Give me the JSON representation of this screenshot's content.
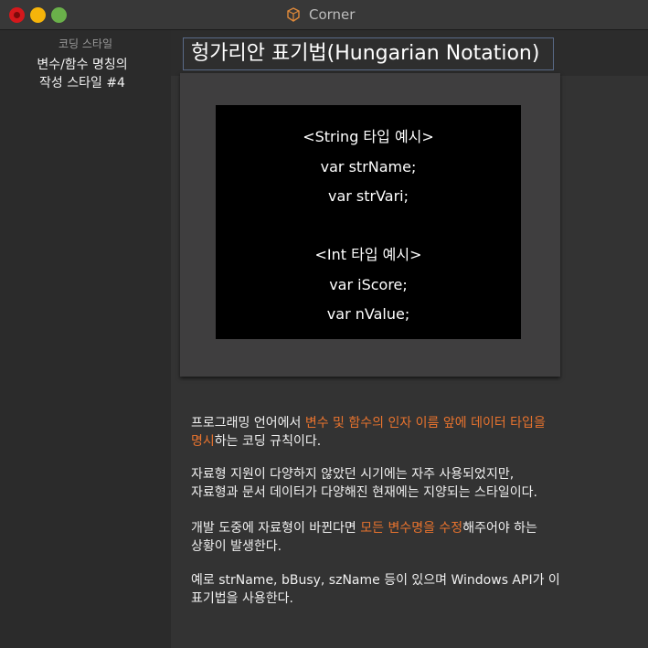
{
  "window": {
    "title": "Corner"
  },
  "sidebar": {
    "section_label": "코딩 스타일",
    "doc_title_line1": "변수/함수 명칭의",
    "doc_title_line2": "작성 스타일 #4"
  },
  "main": {
    "heading": "헝가리안 표기법(Hungarian Notation)",
    "code_lines": [
      "<String 타입 예시>",
      "var strName;",
      "var strVari;",
      "<Int 타입 예시>",
      "var iScore;",
      "var nValue;"
    ],
    "p1": {
      "a": "프로그래밍 언어에서 ",
      "b": "변수 및 함수의 인자 이름 앞에 데이터 타입을",
      "c": "명시",
      "d": "하는 코딩 규칙이다."
    },
    "p2": {
      "line1": "자료형 지원이 다양하지 않았던 시기에는 자주 사용되었지만,",
      "line2": "자료형과 문서 데이터가 다양해진 현재에는 지양되는 스타일이다."
    },
    "p3": {
      "a": "개발 도중에 자료형이 바뀐다면 ",
      "b": "모든 변수명을 수정",
      "c": "해주어야 하는",
      "d": "상황이 발생한다."
    },
    "p4": {
      "line1": "예로 strName, bBusy, szName 등이 있으며 Windows API가 이",
      "line2": "표기법을 사용한다."
    }
  },
  "colors": {
    "accent": "#e8732e",
    "close": "#d4181c",
    "minimize": "#f5b40a",
    "zoom": "#6ab04a"
  }
}
